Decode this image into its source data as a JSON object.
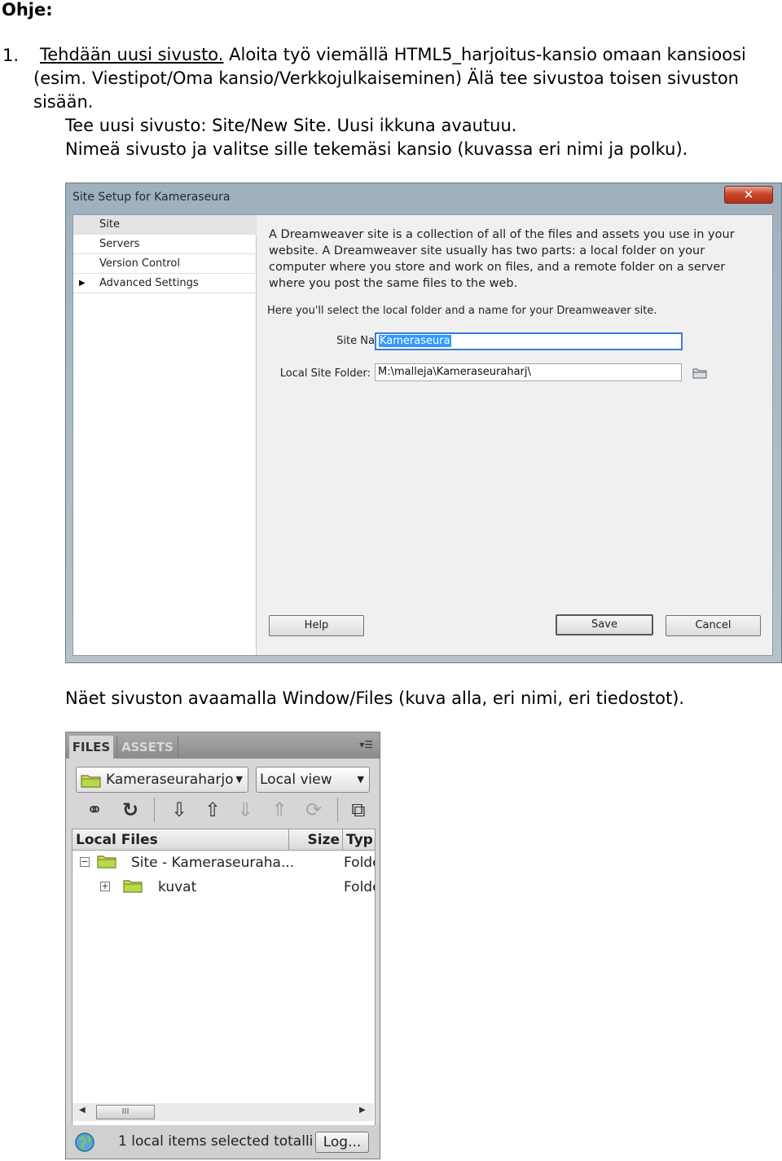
{
  "doc": {
    "heading": "Ohje:",
    "step_number": "1.",
    "step_link": "Tehdään uusi sivusto.",
    "step_line1_rest": " Aloita työ viemällä HTML5_harjoitus-kansio omaan kansioosi",
    "step_line2": "(esim. Viestipot/Oma kansio/Verkkojulkaiseminen) Älä tee sivustoa toisen sivuston",
    "step_line3": "sisään.",
    "step_line4": "Tee uusi sivusto: Site/New Site. Uusi ikkuna avautuu.",
    "step_line5": "Nimeä sivusto ja valitse sille tekemäsi kansio (kuvassa eri nimi ja polku).",
    "between_text": "Näet sivuston avaamalla Window/Files (kuva alla, eri nimi, eri tiedostot)."
  },
  "site_setup": {
    "title": "Site Setup for Kameraseura",
    "close_glyph": "✕",
    "nav": [
      "Site",
      "Servers",
      "Version Control",
      "Advanced Settings"
    ],
    "nav_expand_glyph": "▶",
    "intro": "A Dreamweaver site is a collection of all of the files and assets you use in your website. A Dreamweaver site usually has two parts: a local folder on your computer where you store and work on files, and a remote folder on a server where you post the same files to the web.",
    "hint": "Here you'll select the local folder and a name for your Dreamweaver site.",
    "site_name_label": "Site Name:",
    "site_name_value": "Kameraseura",
    "local_folder_label": "Local Site Folder:",
    "local_folder_value": "M:\\malleja\\Kameraseuraharj\\",
    "help_button": "Help",
    "save_button": "Save",
    "cancel_button": "Cancel"
  },
  "files_panel": {
    "tab_files": "FILES",
    "tab_assets": "ASSETS",
    "menu_glyph": "▾☰",
    "site_dropdown": "Kameraseuraharjo",
    "view_dropdown": "Local view",
    "dropdown_arrow": "▼",
    "col_local_files": "Local Files",
    "col_size": "Size",
    "col_type": "Typ",
    "rows": [
      {
        "name": "Site - Kameraseuraha...",
        "type": "Folde",
        "toggle": "−"
      },
      {
        "name": "kuvat",
        "type": "Folde",
        "toggle": "+"
      }
    ],
    "scroll_left": "◀",
    "scroll_right": "▶",
    "scroll_thumb": "III",
    "status_text": "1 local items selected totalli",
    "log_button": "Log..."
  }
}
